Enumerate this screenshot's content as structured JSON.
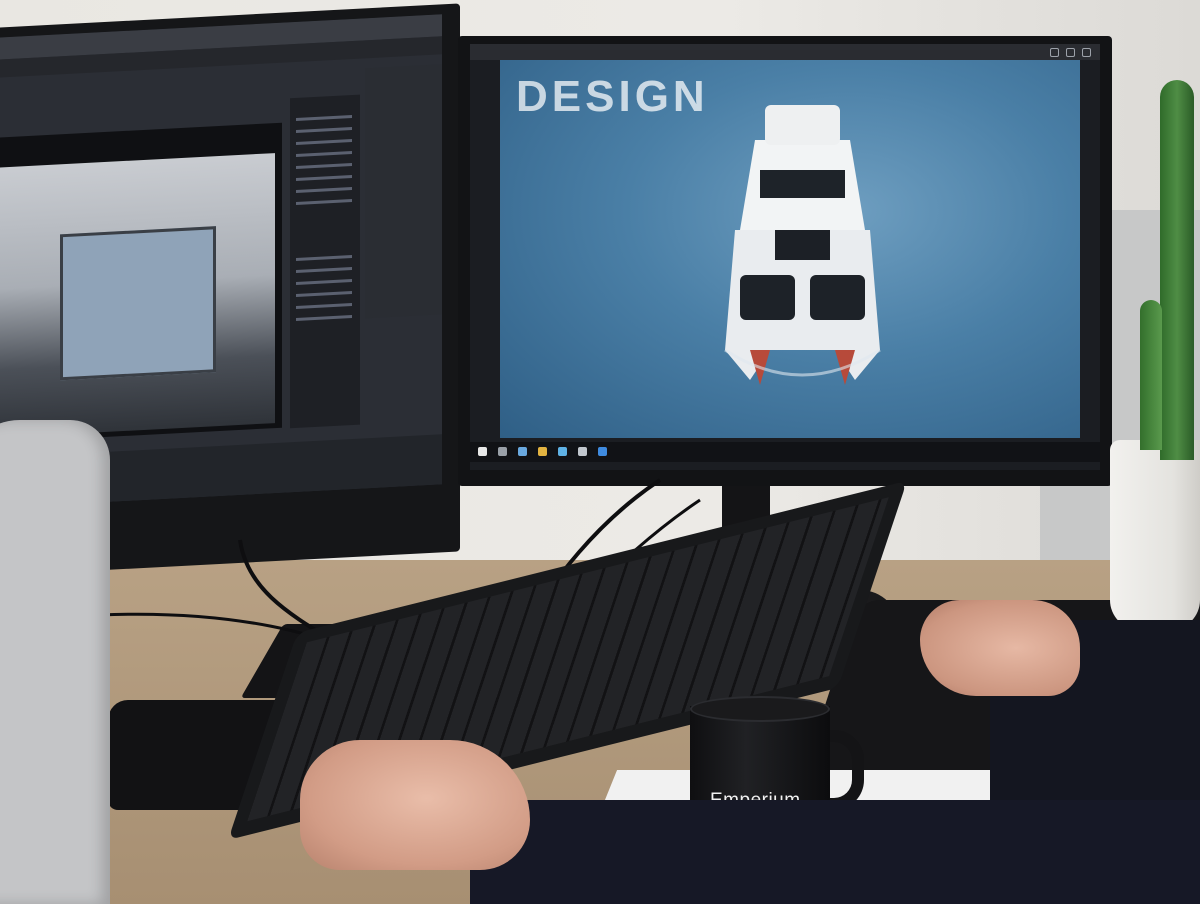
{
  "scene": {
    "description_type": "photo",
    "right_monitor": {
      "photo_headline": "DESIGN"
    },
    "mug": {
      "logo_text": "Emperium"
    }
  },
  "colors": {
    "sea": "#4a7fa6",
    "mug": "#111112",
    "desk": "#b09a7e"
  }
}
